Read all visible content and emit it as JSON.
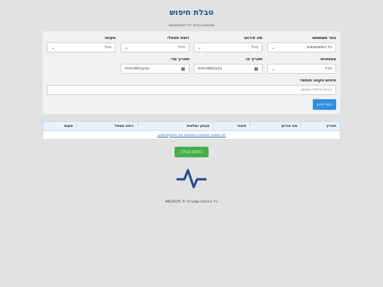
{
  "page": {
    "title": "טבלת חיפוש",
    "user_line": "משתמש נוכחי: כל המשתמשים"
  },
  "filters": {
    "user": {
      "label": "בחר משתמש:",
      "value": "כל המשתמשים"
    },
    "event_type": {
      "label": "סוג אירוע:",
      "value": "הכל"
    },
    "reporting_doctor": {
      "label": "רופא מטפל:",
      "value": "הכל"
    },
    "location": {
      "label": "מקום:",
      "value": "הכל"
    },
    "findings": {
      "label": "ממצאים:",
      "value": "הכל"
    },
    "date_from": {
      "label": "תאריך מ:",
      "value": "mm/dd/yyyy"
    },
    "date_to": {
      "label": "תאריך עד:",
      "value": "mm/dd/yyyy"
    },
    "free_text": {
      "label": "חיפוש טקסט חופשי:",
      "placeholder": "הכנס מילות חיפוש..."
    },
    "clear_label": "נקה סינון"
  },
  "table": {
    "headers": [
      "תאריך",
      "סוג אירוע",
      "תיאור",
      "אבחון ומלצות",
      "רופא מטפל",
      "מקום"
    ],
    "empty_message": "לא נמצאו תוצאות התואמות את הסינון/חיפוש."
  },
  "actions": {
    "print_label": "הדפס טבלה"
  },
  "logo": {
    "icon": "pulse-icon",
    "color": "#1d4f91"
  },
  "footer": {
    "text": "כל הזכויות שמורות © AR2025"
  },
  "colors": {
    "accent": "#1d4f91",
    "clear_button": "#2d8fe0",
    "print_button": "#45b04a"
  }
}
